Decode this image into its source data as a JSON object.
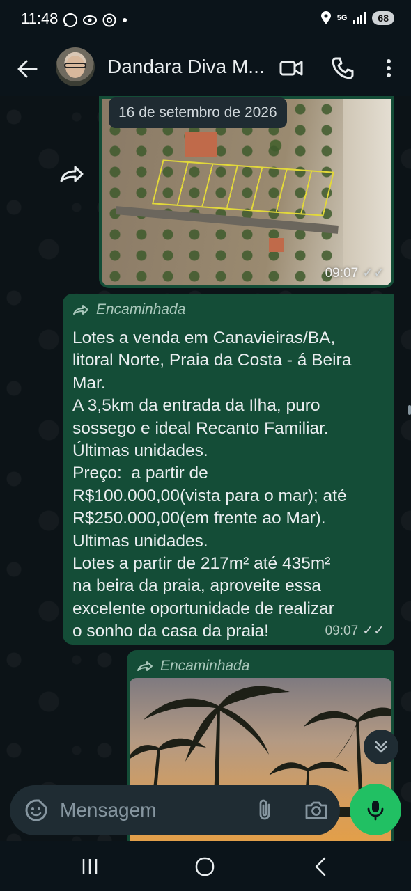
{
  "status_bar": {
    "time": "11:48",
    "battery": "68",
    "network": "5G"
  },
  "header": {
    "contact_name": "Dandara Diva M..."
  },
  "messages": {
    "image1": {
      "date_chip": "16 de setembro de 2026",
      "time": "09:07"
    },
    "text": {
      "forwarded_label": "Encaminhada",
      "body": "Lotes a venda em Canavieiras/BA,\nlitoral Norte, Praia da Costa - á Beira\nMar.\nA 3,5km da entrada da Ilha, puro\nsossego e ideal Recanto Familiar.\nÚltimas unidades.\nPreço:  a partir de\nR$100.000,00(vista para o mar); até\nR$250.000,00(em frente ao Mar).\nUltimas unidades.\nLotes a partir de 217m² até 435m²\nna beira da praia, aproveite essa\nexcelente oportunidade de realizar\no sonho da casa da praia!",
      "time": "09:07"
    },
    "image2": {
      "forwarded_label": "Encaminhada"
    }
  },
  "input": {
    "placeholder": "Mensagem"
  },
  "colors": {
    "outgoing_bubble": "#144d37",
    "background": "#0b141a",
    "accent": "#21c063"
  }
}
